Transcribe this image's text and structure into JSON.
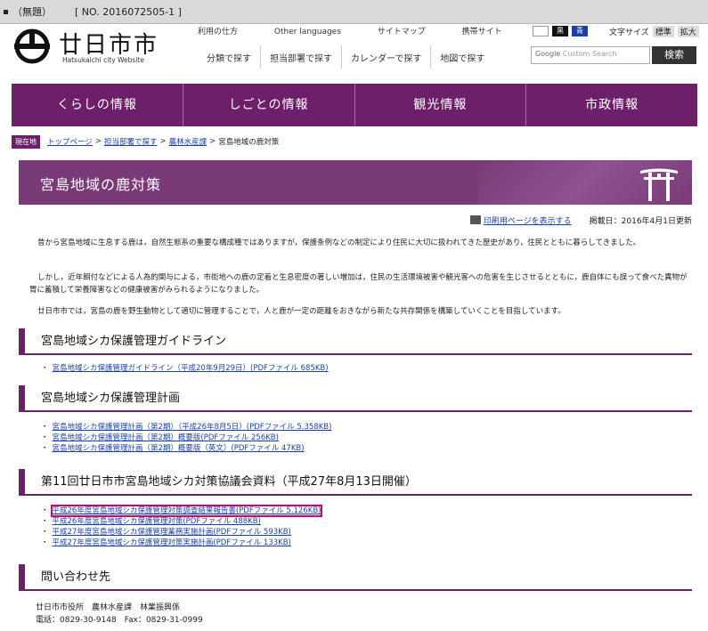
{
  "window": {
    "title_left": "（無題）",
    "title_right": "[ NO. 2016072505-1 ]"
  },
  "header": {
    "logo_text": "廿日市市",
    "logo_sub": "Hatsukaichi city Website",
    "top_links": [
      "利用の仕方",
      "Other languages",
      "サイトマップ",
      "携帯サイト"
    ],
    "sub_links": [
      "分類で探す",
      "担当部署で探す",
      "カレンダーで探す",
      "地図で探す"
    ],
    "access_label": "文字サイズ",
    "access_standard": "標準",
    "access_large": "拡大",
    "search_placeholder_brand": "Google",
    "search_placeholder": "Custom Search",
    "search_button": "検索"
  },
  "mainnav": [
    "くらしの情報",
    "しごとの情報",
    "観光情報",
    "市政情報"
  ],
  "breadcrumb": {
    "here": "現在地",
    "items": [
      "トップページ",
      "担当部署で探す",
      "農林水産課"
    ],
    "current": "宮島地域の鹿対策"
  },
  "page": {
    "title": "宮島地域の鹿対策",
    "print_link": "印刷用ページを表示する",
    "posted": "掲載日：2016年4月1日更新",
    "paragraphs": [
      "昔から宮島地域に生息する鹿は，自然生態系の重要な構成種ではありますが，保護条例などの制定により住民に大切に扱われてきた歴史があり，住民とともに暮らしてきました。",
      "しかし，近年餌付などによる人為的関与による，市街地への鹿の定着と生息密度の著しい増加は，住民の生活環境被害や観光客への危害を生じさせるとともに，鹿自体にも誤って食べた異物が胃に蓄積して栄養障害などの健康被害がみられるようになりました。",
      "廿日市市では，宮島の鹿を野生動物として適切に管理することで，人と鹿が一定の距離をおきながら新たな共存関係を構築していくことを目指しています。"
    ]
  },
  "sections": [
    {
      "title": "宮島地域シカ保護管理ガイドライン",
      "links": [
        "宮島地域シカ保護管理ガイドライン（平成20年9月29日）(PDFファイル 685KB)"
      ]
    },
    {
      "title": "宮島地域シカ保護管理計画",
      "links": [
        "宮島地域シカ保護管理計画（第2期）（平成26年8月5日）(PDFファイル 5.358KB)",
        "宮島地域シカ保護管理計画（第2期）概要版(PDFファイル 256KB)",
        "宮島地域シカ保護管理計画（第2期）概要版（英文）(PDFファイル 47KB)"
      ]
    },
    {
      "title": "第11回廿日市市宮島地域シカ対策協議会資料（平成27年8月13日開催）",
      "links": [
        "平成26年度宮島地域シカ保護管理対策調査結果報告書(PDFファイル 5.126KB)",
        "平成26年度宮島地域シカ保護管理対策(PDFファイル 488KB)",
        "平成27年度宮島地域シカ保護管理業務実施計画(PDFファイル 593KB)",
        "平成27年度宮島地域シカ保護管理対策実施計画(PDFファイル 133KB)"
      ]
    },
    {
      "title": "問い合わせ先",
      "links": []
    }
  ],
  "contact": {
    "line1": "廿日市市役所　農林水産課　林業振興係",
    "line2": "電話：0829-30-9148　Fax：0829-31-0999"
  },
  "colors": {
    "accent": "#6e1f6a",
    "link": "#1a3fa8",
    "highlight": "#d0006f"
  }
}
